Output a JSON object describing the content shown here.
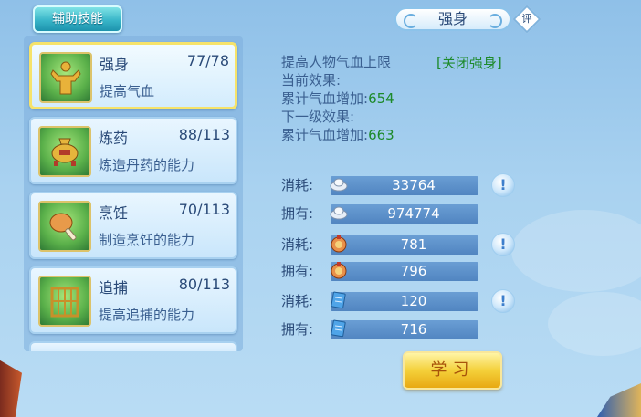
{
  "tabs": {
    "assist_label": "辅助技能"
  },
  "skills": [
    {
      "name": "强身",
      "progress": "77/78",
      "desc": "提高气血",
      "icon": "strongman-icon",
      "selected": true
    },
    {
      "name": "炼药",
      "progress": "88/113",
      "desc": "炼造丹药的能力",
      "icon": "cauldron-icon",
      "selected": false
    },
    {
      "name": "烹饪",
      "progress": "70/113",
      "desc": "制造烹饪的能力",
      "icon": "drumstick-icon",
      "selected": false
    },
    {
      "name": "追捕",
      "progress": "80/113",
      "desc": "提高追捕的能力",
      "icon": "cage-icon",
      "selected": false
    }
  ],
  "detail": {
    "title": "强身",
    "rate_label": "评",
    "line1": "提高人物气血上限",
    "close_link": "[关闭强身]",
    "current_header": "当前效果:",
    "current_label": "累计气血增加:",
    "current_value": "654",
    "next_header": "下一级效果:",
    "next_label": "累计气血增加:",
    "next_value": "663"
  },
  "resources": [
    {
      "label": "消耗:",
      "value": "33764",
      "icon": "silver-ingot-icon",
      "has_info": true
    },
    {
      "label": "拥有:",
      "value": "974774",
      "icon": "silver-ingot-icon",
      "has_info": false
    },
    {
      "label": "消耗:",
      "value": "781",
      "icon": "contribution-medal-icon",
      "has_info": true
    },
    {
      "label": "拥有:",
      "value": "796",
      "icon": "contribution-medal-icon",
      "has_info": false
    },
    {
      "label": "消耗:",
      "value": "120",
      "icon": "scroll-book-icon",
      "has_info": true
    },
    {
      "label": "拥有:",
      "value": "716",
      "icon": "scroll-book-icon",
      "has_info": false
    }
  ],
  "info_glyph": "!",
  "learn_button": "学习",
  "colors": {
    "accent_green": "#1d8a2a",
    "selected_border": "#f6e36a",
    "button_gold": "#f4d03a"
  }
}
